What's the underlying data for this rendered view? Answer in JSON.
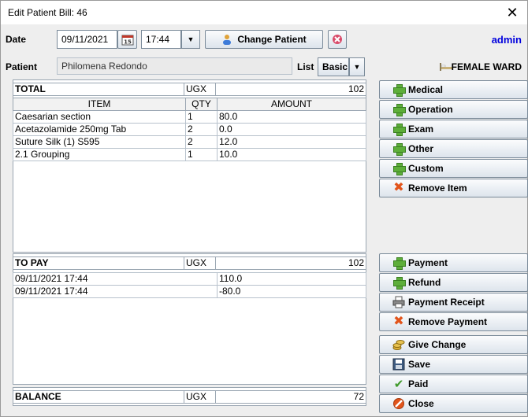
{
  "window": {
    "title": "Edit Patient Bill: 46"
  },
  "header": {
    "date_label": "Date",
    "date_value": "09/11/2021",
    "time_value": "17:44",
    "change_patient_label": "Change Patient",
    "user": "admin",
    "patient_label": "Patient",
    "patient_name": "Philomena Redondo",
    "list_label": "List",
    "list_value": "Basic",
    "ward": "FEMALE WARD"
  },
  "items_table": {
    "total_label": "TOTAL",
    "currency": "UGX",
    "total_value": "102",
    "columns": [
      "ITEM",
      "QTY",
      "AMOUNT"
    ],
    "rows": [
      [
        "Caesarian section",
        "1",
        "80.0"
      ],
      [
        "Acetazolamide 250mg Tab",
        "2",
        "0.0"
      ],
      [
        "Suture Silk (1) S595",
        "2",
        "12.0"
      ],
      [
        "2.1 Grouping",
        "1",
        "10.0"
      ]
    ]
  },
  "payments_table": {
    "to_pay_label": "TO PAY",
    "currency": "UGX",
    "to_pay_value": "102",
    "rows": [
      [
        "09/11/2021 17:44",
        "110.0"
      ],
      [
        "09/11/2021 17:44",
        "-80.0"
      ]
    ]
  },
  "balance": {
    "label": "BALANCE",
    "currency": "UGX",
    "value": "72"
  },
  "buttons": {
    "medical": "Medical",
    "operation": "Operation",
    "exam": "Exam",
    "other": "Other",
    "custom": "Custom",
    "remove_item": "Remove Item",
    "payment": "Payment",
    "refund": "Refund",
    "payment_receipt": "Payment Receipt",
    "remove_payment": "Remove Payment",
    "give_change": "Give Change",
    "save": "Save",
    "paid": "Paid",
    "close": "Close"
  }
}
